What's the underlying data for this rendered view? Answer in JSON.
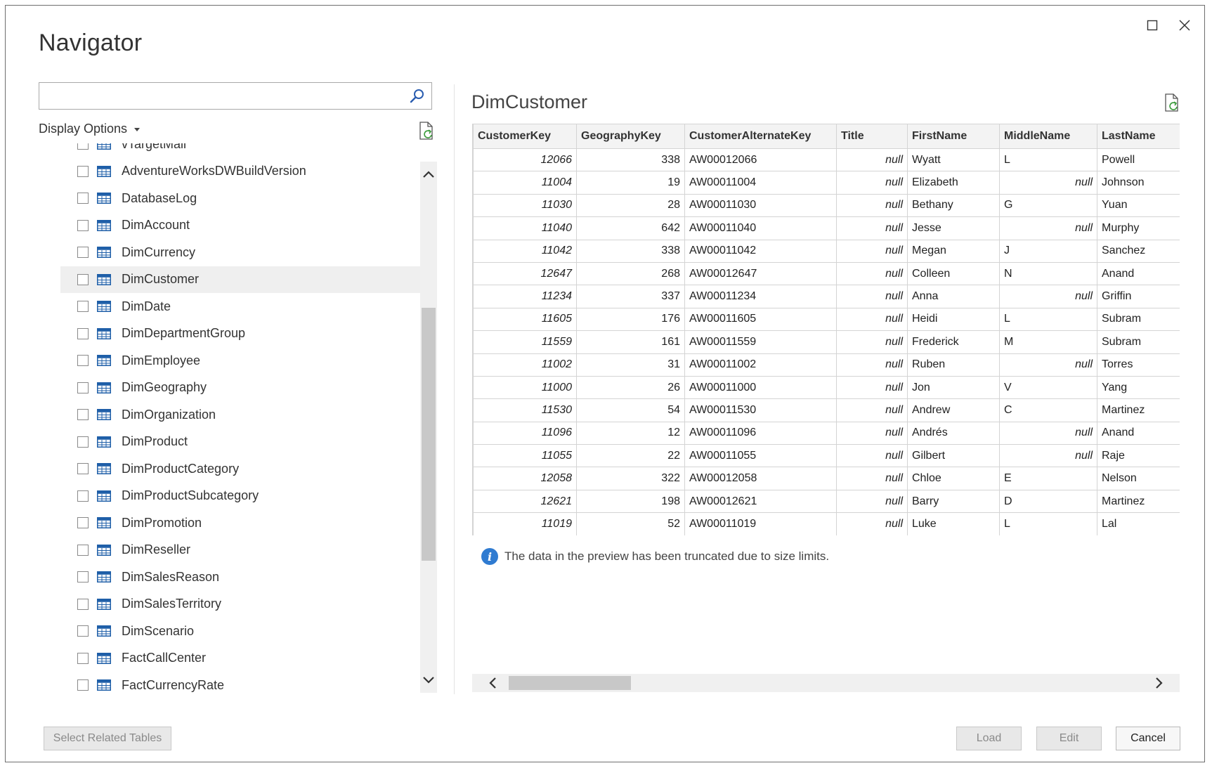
{
  "window": {
    "title": "Navigator",
    "controls": {
      "maximize": "maximize-icon",
      "close": "close-icon"
    }
  },
  "left_pane": {
    "search": {
      "value": "",
      "placeholder": ""
    },
    "display_options_label": "Display Options",
    "items": [
      {
        "label": "vTargetMail",
        "selected": false
      },
      {
        "label": "AdventureWorksDWBuildVersion",
        "selected": false
      },
      {
        "label": "DatabaseLog",
        "selected": false
      },
      {
        "label": "DimAccount",
        "selected": false
      },
      {
        "label": "DimCurrency",
        "selected": false
      },
      {
        "label": "DimCustomer",
        "selected": true
      },
      {
        "label": "DimDate",
        "selected": false
      },
      {
        "label": "DimDepartmentGroup",
        "selected": false
      },
      {
        "label": "DimEmployee",
        "selected": false
      },
      {
        "label": "DimGeography",
        "selected": false
      },
      {
        "label": "DimOrganization",
        "selected": false
      },
      {
        "label": "DimProduct",
        "selected": false
      },
      {
        "label": "DimProductCategory",
        "selected": false
      },
      {
        "label": "DimProductSubcategory",
        "selected": false
      },
      {
        "label": "DimPromotion",
        "selected": false
      },
      {
        "label": "DimReseller",
        "selected": false
      },
      {
        "label": "DimSalesReason",
        "selected": false
      },
      {
        "label": "DimSalesTerritory",
        "selected": false
      },
      {
        "label": "DimScenario",
        "selected": false
      },
      {
        "label": "FactCallCenter",
        "selected": false
      },
      {
        "label": "FactCurrencyRate",
        "selected": false
      }
    ]
  },
  "preview": {
    "title": "DimCustomer",
    "columns": [
      "CustomerKey",
      "GeographyKey",
      "CustomerAlternateKey",
      "Title",
      "FirstName",
      "MiddleName",
      "LastName"
    ],
    "rows": [
      [
        "12066",
        "338",
        "AW00012066",
        "null",
        "Wyatt",
        "L",
        "Powell"
      ],
      [
        "11004",
        "19",
        "AW00011004",
        "null",
        "Elizabeth",
        "null",
        "Johnson"
      ],
      [
        "11030",
        "28",
        "AW00011030",
        "null",
        "Bethany",
        "G",
        "Yuan"
      ],
      [
        "11040",
        "642",
        "AW00011040",
        "null",
        "Jesse",
        "null",
        "Murphy"
      ],
      [
        "11042",
        "338",
        "AW00011042",
        "null",
        "Megan",
        "J",
        "Sanchez"
      ],
      [
        "12647",
        "268",
        "AW00012647",
        "null",
        "Colleen",
        "N",
        "Anand"
      ],
      [
        "11234",
        "337",
        "AW00011234",
        "null",
        "Anna",
        "null",
        "Griffin"
      ],
      [
        "11605",
        "176",
        "AW00011605",
        "null",
        "Heidi",
        "L",
        "Subram"
      ],
      [
        "11559",
        "161",
        "AW00011559",
        "null",
        "Frederick",
        "M",
        "Subram"
      ],
      [
        "11002",
        "31",
        "AW00011002",
        "null",
        "Ruben",
        "null",
        "Torres"
      ],
      [
        "11000",
        "26",
        "AW00011000",
        "null",
        "Jon",
        "V",
        "Yang"
      ],
      [
        "11530",
        "54",
        "AW00011530",
        "null",
        "Andrew",
        "C",
        "Martinez"
      ],
      [
        "11096",
        "12",
        "AW00011096",
        "null",
        "Andrés",
        "null",
        "Anand"
      ],
      [
        "11055",
        "22",
        "AW00011055",
        "null",
        "Gilbert",
        "null",
        "Raje"
      ],
      [
        "12058",
        "322",
        "AW00012058",
        "null",
        "Chloe",
        "E",
        "Nelson"
      ],
      [
        "12621",
        "198",
        "AW00012621",
        "null",
        "Barry",
        "D",
        "Martinez"
      ],
      [
        "11019",
        "52",
        "AW00011019",
        "null",
        "Luke",
        "L",
        "Lal"
      ]
    ],
    "info_message": "The data in the preview has been truncated due to size limits."
  },
  "buttons": {
    "select_related": "Select Related Tables",
    "load": "Load",
    "edit": "Edit",
    "cancel": "Cancel"
  },
  "colors": {
    "accent_info": "#2f7bd1",
    "table_icon": "#1f5fa8"
  }
}
